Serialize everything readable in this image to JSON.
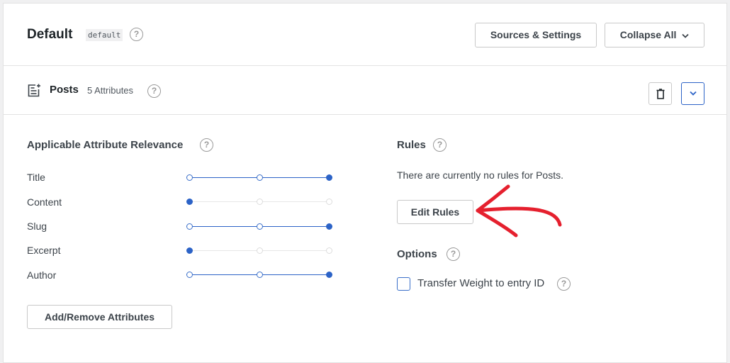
{
  "engine": {
    "title": "Default",
    "slug": "default",
    "help_symbol": "?"
  },
  "header_buttons": {
    "sources_settings": "Sources & Settings",
    "collapse_all": "Collapse All"
  },
  "source": {
    "name": "Posts",
    "attribute_count": "5 Attributes"
  },
  "relevance": {
    "title": "Applicable Attribute Relevance",
    "attributes": [
      {
        "label": "Title",
        "weight": 3
      },
      {
        "label": "Content",
        "weight": 1
      },
      {
        "label": "Slug",
        "weight": 3
      },
      {
        "label": "Excerpt",
        "weight": 1
      },
      {
        "label": "Author",
        "weight": 3
      }
    ],
    "add_remove_button": "Add/Remove Attributes"
  },
  "rules": {
    "title": "Rules",
    "empty_text": "There are currently no rules for Posts.",
    "edit_button": "Edit Rules"
  },
  "options": {
    "title": "Options",
    "transfer_weight_label": "Transfer Weight to entry ID",
    "transfer_weight_checked": false
  },
  "colors": {
    "accent": "#2c63c7",
    "annotation_arrow": "#e5202e"
  }
}
